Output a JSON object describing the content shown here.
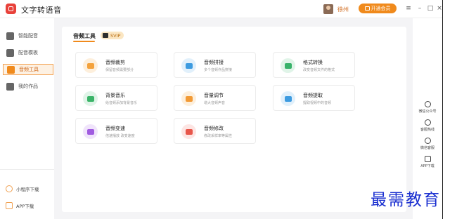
{
  "app": {
    "title": "文字转语音"
  },
  "user": {
    "name": "徐州",
    "vip_button": "开通会员"
  },
  "sidebar": {
    "items": [
      {
        "label": "智能配音",
        "icon": "robot-icon"
      },
      {
        "label": "配音模板",
        "icon": "template-icon"
      },
      {
        "label": "音频工具",
        "icon": "audio-tools-icon",
        "active": true
      },
      {
        "label": "我的作品",
        "icon": "folder-icon"
      }
    ],
    "bottom": [
      {
        "label": "小程序下载",
        "icon": "mini-program-icon"
      },
      {
        "label": "APP下载",
        "icon": "phone-icon"
      }
    ]
  },
  "main": {
    "tab": "音频工具",
    "badge": "SVIP",
    "tools": [
      {
        "name": "音频裁剪",
        "desc": "保留音频需要部分",
        "icon": "rewind-icon",
        "color": "#f4a23c",
        "bg": "#fdefdc"
      },
      {
        "name": "音频拼接",
        "desc": "多个音频作品拼接",
        "icon": "merge-icon",
        "color": "#3d9be0",
        "bg": "#e1f0fb"
      },
      {
        "name": "格式转换",
        "desc": "改变音频文件的格式",
        "icon": "convert-icon",
        "color": "#38b26a",
        "bg": "#e0f4e8"
      },
      {
        "name": "背景音乐",
        "desc": "给音频添加背景音乐",
        "icon": "music-icon",
        "color": "#3ab468",
        "bg": "#e0f4e8"
      },
      {
        "name": "音量调节",
        "desc": "增大音频声音",
        "icon": "volume-icon",
        "color": "#f29a35",
        "bg": "#fdefdc"
      },
      {
        "name": "音频提取",
        "desc": "提取视频中的音频",
        "icon": "extract-icon",
        "color": "#3d9be0",
        "bg": "#e1f0fb"
      },
      {
        "name": "音频变速",
        "desc": "倍速播放 改变速度",
        "icon": "speed-icon",
        "color": "#a05be0",
        "bg": "#f0e4fb"
      },
      {
        "name": "音频修改",
        "desc": "修改采样率等属性",
        "icon": "bar-chart-icon",
        "color": "#e8564a",
        "bg": "#fde5e3"
      }
    ]
  },
  "right_bar": [
    {
      "label": "微信公众号",
      "icon": "wechat-icon"
    },
    {
      "label": "客服热线",
      "icon": "phone-call-icon"
    },
    {
      "label": "微信客服",
      "icon": "heart-icon"
    },
    {
      "label": "APP下载",
      "icon": "phone-icon"
    }
  ],
  "watermark": "最需教育"
}
